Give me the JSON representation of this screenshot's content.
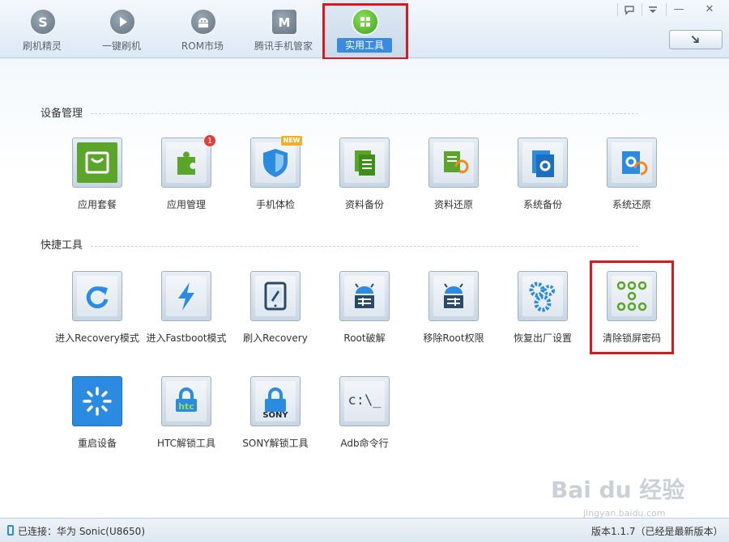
{
  "nav": {
    "tabs": [
      {
        "label": "刷机精灵",
        "icon": "flash-genie-icon"
      },
      {
        "label": "一键刷机",
        "icon": "play-icon"
      },
      {
        "label": "ROM市场",
        "icon": "android-icon"
      },
      {
        "label": "腾讯手机管家",
        "icon": "shield-m-icon"
      },
      {
        "label": "实用工具",
        "icon": "grid-icon",
        "active": true
      }
    ]
  },
  "window": {
    "feedback_icon": "speech-bubble-icon",
    "menu_icon": "dropdown-menu-icon",
    "minimize_label": "—",
    "close_label": "✕",
    "download_label": "➔"
  },
  "sections": {
    "device": {
      "title": "设备管理",
      "items": [
        {
          "label": "应用套餐",
          "icon": "shopping-bag-icon",
          "color": "#5aa52a"
        },
        {
          "label": "应用管理",
          "icon": "puzzle-icon",
          "color": "#5aa52a",
          "badge": "1"
        },
        {
          "label": "手机体检",
          "icon": "shield-icon",
          "color": "#2b8be0",
          "badge_new": "NEW"
        },
        {
          "label": "资料备份",
          "icon": "document-backup-icon",
          "color": "#5aa52a"
        },
        {
          "label": "资料还原",
          "icon": "document-restore-icon",
          "color": "#5aa52a"
        },
        {
          "label": "系统备份",
          "icon": "system-backup-icon",
          "color": "#2b8be0"
        },
        {
          "label": "系统还原",
          "icon": "system-restore-icon",
          "color": "#2b8be0"
        }
      ]
    },
    "quick": {
      "title": "快捷工具",
      "items": [
        {
          "label": "进入Recovery模式",
          "icon": "refresh-icon"
        },
        {
          "label": "进入Fastboot模式",
          "icon": "lightning-icon"
        },
        {
          "label": "刷入Recovery",
          "icon": "tablet-edit-icon"
        },
        {
          "label": "Root破解",
          "icon": "android-unlock-icon"
        },
        {
          "label": "移除Root权限",
          "icon": "android-lock-icon"
        },
        {
          "label": "恢复出厂设置",
          "icon": "gears-icon"
        },
        {
          "label": "清除锁屏密码",
          "icon": "pattern-lock-icon"
        },
        {
          "label": "重启设备",
          "icon": "restart-spinner-icon"
        },
        {
          "label": "HTC解锁工具",
          "icon": "htc-lock-icon",
          "brand": "htc"
        },
        {
          "label": "SONY解锁工具",
          "icon": "sony-lock-icon",
          "brand": "SONY"
        },
        {
          "label": "Adb命令行",
          "icon": "terminal-icon",
          "text": "c:\\_"
        }
      ]
    }
  },
  "status": {
    "connection": "已连接：华为 Sonic(U8650)",
    "version": "版本1.1.7（已经是最新版本）"
  },
  "watermark": {
    "logo": "Bai du 经验",
    "url": "jingyan.baidu.com"
  },
  "colors": {
    "accent_blue": "#2b8be0",
    "accent_green": "#5aa52a",
    "highlight_red": "#d9191e"
  }
}
